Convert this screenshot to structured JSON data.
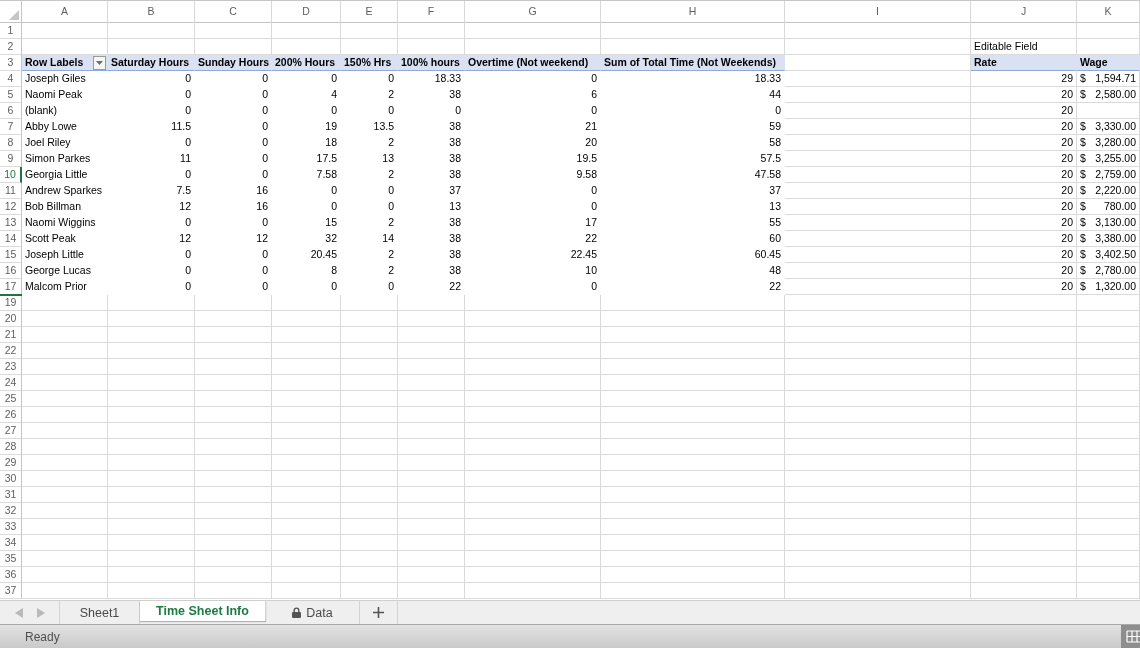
{
  "sheet": {
    "columns": [
      "A",
      "B",
      "C",
      "D",
      "E",
      "F",
      "G",
      "H",
      "I",
      "J",
      "K"
    ],
    "rows": [
      {
        "kind": "row",
        "number": "1",
        "selected": false
      },
      {
        "kind": "row",
        "number": "2",
        "selected": false
      },
      {
        "kind": "row",
        "number": "3",
        "selected": false
      },
      {
        "kind": "row",
        "number": "4",
        "selected": false
      },
      {
        "kind": "row",
        "number": "5",
        "selected": false
      },
      {
        "kind": "row",
        "number": "6",
        "selected": false
      },
      {
        "kind": "row",
        "number": "7",
        "selected": false
      },
      {
        "kind": "row",
        "number": "8",
        "selected": false
      },
      {
        "kind": "row",
        "number": "9",
        "selected": false
      },
      {
        "kind": "row",
        "number": "10",
        "selected": true
      },
      {
        "kind": "row",
        "number": "11",
        "selected": false
      },
      {
        "kind": "row",
        "number": "12",
        "selected": false
      },
      {
        "kind": "row",
        "number": "13",
        "selected": false
      },
      {
        "kind": "row",
        "number": "14",
        "selected": false
      },
      {
        "kind": "row",
        "number": "15",
        "selected": false
      },
      {
        "kind": "row",
        "number": "16",
        "selected": false
      },
      {
        "kind": "row",
        "number": "17",
        "selected": false
      },
      {
        "kind": "hidden"
      },
      {
        "kind": "row",
        "number": "19",
        "selected": false
      },
      {
        "kind": "row",
        "number": "20",
        "selected": false
      },
      {
        "kind": "row",
        "number": "21",
        "selected": false
      },
      {
        "kind": "row",
        "number": "22",
        "selected": false
      },
      {
        "kind": "row",
        "number": "23",
        "selected": false
      },
      {
        "kind": "row",
        "number": "24",
        "selected": false
      },
      {
        "kind": "row",
        "number": "25",
        "selected": false
      },
      {
        "kind": "row",
        "number": "26",
        "selected": false
      },
      {
        "kind": "row",
        "number": "27",
        "selected": false
      },
      {
        "kind": "row",
        "number": "28",
        "selected": false
      },
      {
        "kind": "row",
        "number": "29",
        "selected": false
      },
      {
        "kind": "row",
        "number": "30",
        "selected": false
      },
      {
        "kind": "row",
        "number": "31",
        "selected": false
      },
      {
        "kind": "row",
        "number": "32",
        "selected": false
      },
      {
        "kind": "row",
        "number": "33",
        "selected": false
      },
      {
        "kind": "row",
        "number": "34",
        "selected": false
      },
      {
        "kind": "row",
        "number": "35",
        "selected": false
      },
      {
        "kind": "row",
        "number": "36",
        "selected": false
      },
      {
        "kind": "row",
        "number": "37",
        "selected": false
      }
    ],
    "pivot": {
      "headers": [
        "Row Labels",
        "Saturday Hours",
        "Sunday Hours",
        "200% Hours",
        "150% Hrs",
        "100% hours",
        "Overtime (Not weekend)",
        "Sum of Total Time (Not Weekends)"
      ],
      "rows": [
        {
          "label": "Joseph Giles",
          "values": [
            "0",
            "0",
            "0",
            "0",
            "18.33",
            "0",
            "18.33"
          ]
        },
        {
          "label": "Naomi Peak",
          "values": [
            "0",
            "0",
            "4",
            "2",
            "38",
            "6",
            "44"
          ]
        },
        {
          "label": "(blank)",
          "values": [
            "0",
            "0",
            "0",
            "0",
            "0",
            "0",
            "0"
          ]
        },
        {
          "label": "Abby Lowe",
          "values": [
            "11.5",
            "0",
            "19",
            "13.5",
            "38",
            "21",
            "59"
          ]
        },
        {
          "label": "Joel Riley",
          "values": [
            "0",
            "0",
            "18",
            "2",
            "38",
            "20",
            "58"
          ]
        },
        {
          "label": "Simon Parkes",
          "values": [
            "11",
            "0",
            "17.5",
            "13",
            "38",
            "19.5",
            "57.5"
          ]
        },
        {
          "label": "Georgia Little",
          "values": [
            "0",
            "0",
            "7.58",
            "2",
            "38",
            "9.58",
            "47.58"
          ]
        },
        {
          "label": "Andrew Sparkes",
          "values": [
            "7.5",
            "16",
            "0",
            "0",
            "37",
            "0",
            "37"
          ]
        },
        {
          "label": "Bob Billman",
          "values": [
            "12",
            "16",
            "0",
            "0",
            "13",
            "0",
            "13"
          ]
        },
        {
          "label": "Naomi Wiggins",
          "values": [
            "0",
            "0",
            "15",
            "2",
            "38",
            "17",
            "55"
          ]
        },
        {
          "label": "Scott Peak",
          "values": [
            "12",
            "12",
            "32",
            "14",
            "38",
            "22",
            "60"
          ]
        },
        {
          "label": "Joseph Little",
          "values": [
            "0",
            "0",
            "20.45",
            "2",
            "38",
            "22.45",
            "60.45"
          ]
        },
        {
          "label": "George Lucas",
          "values": [
            "0",
            "0",
            "8",
            "2",
            "38",
            "10",
            "48"
          ]
        },
        {
          "label": "Malcom Prior",
          "values": [
            "0",
            "0",
            "0",
            "0",
            "22",
            "0",
            "22"
          ]
        }
      ]
    },
    "rate_table": {
      "title": "Editable Field",
      "headers": [
        "Rate",
        "Wage"
      ],
      "rows": [
        {
          "rate": "29",
          "wage": {
            "currency": "$",
            "amount": "1,594.71"
          }
        },
        {
          "rate": "20",
          "wage": {
            "currency": "$",
            "amount": "2,580.00"
          }
        },
        {
          "rate": "20"
        },
        {
          "rate": "20",
          "wage": {
            "currency": "$",
            "amount": "3,330.00"
          }
        },
        {
          "rate": "20",
          "wage": {
            "currency": "$",
            "amount": "3,280.00"
          }
        },
        {
          "rate": "20",
          "wage": {
            "currency": "$",
            "amount": "3,255.00"
          }
        },
        {
          "rate": "20",
          "wage": {
            "currency": "$",
            "amount": "2,759.00"
          }
        },
        {
          "rate": "20",
          "wage": {
            "currency": "$",
            "amount": "2,220.00"
          }
        },
        {
          "rate": "20",
          "wage": {
            "currency": "$",
            "amount": "780.00"
          }
        },
        {
          "rate": "20",
          "wage": {
            "currency": "$",
            "amount": "3,130.00"
          }
        },
        {
          "rate": "20",
          "wage": {
            "currency": "$",
            "amount": "3,380.00"
          }
        },
        {
          "rate": "20",
          "wage": {
            "currency": "$",
            "amount": "3,402.50"
          }
        },
        {
          "rate": "20",
          "wage": {
            "currency": "$",
            "amount": "2,780.00"
          }
        },
        {
          "rate": "20",
          "wage": {
            "currency": "$",
            "amount": "1,320.00"
          }
        }
      ]
    }
  },
  "sheet_tabs": [
    {
      "label": "Sheet1",
      "selected": false,
      "locked": false
    },
    {
      "label": "Time Sheet Info",
      "selected": true,
      "locked": false
    },
    {
      "label": "Data",
      "selected": false,
      "locked": true
    }
  ],
  "status_bar": {
    "text": "Ready"
  }
}
